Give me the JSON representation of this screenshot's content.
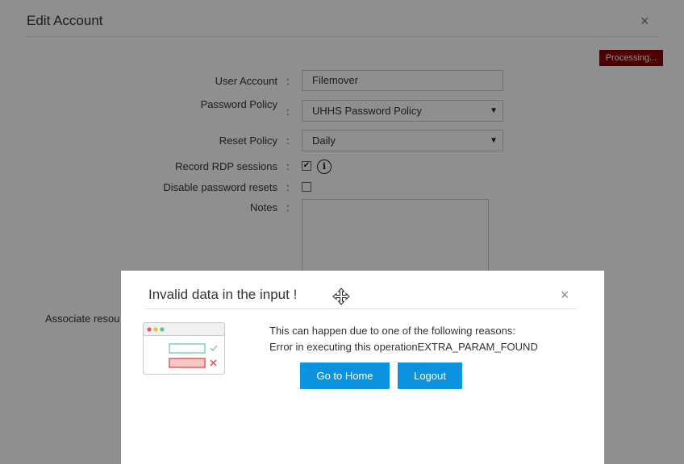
{
  "edit_account": {
    "title": "Edit Account",
    "close_symbol": "×",
    "processing_label": "Processing...",
    "colon": ":",
    "fields": {
      "user_account": {
        "label": "User Account",
        "value": "Filemover"
      },
      "password_policy": {
        "label": "Password Policy",
        "value": "UHHS Password Policy"
      },
      "reset_policy": {
        "label": "Reset Policy",
        "value": "Daily"
      },
      "record_rdp": {
        "label": "Record RDP sessions",
        "checked": true
      },
      "disable_resets": {
        "label": "Disable password resets",
        "checked": false
      },
      "notes": {
        "label": "Notes",
        "value": ""
      }
    },
    "associate_label": "Associate resou",
    "checkmark": "✔",
    "dropdown_arrow": "▼",
    "info_symbol": "i"
  },
  "modal": {
    "title": "Invalid data in the input !",
    "close_symbol": "×",
    "message_line1": "This can happen due to one of the following reasons:",
    "message_line2": "Error in executing this operationEXTRA_PARAM_FOUND",
    "go_home_label": "Go to Home",
    "logout_label": "Logout",
    "icons": {
      "move": "move-icon",
      "illustration": "invalid-form-illustration-icon"
    }
  },
  "colors": {
    "processing_badge": "#8b0000",
    "button_primary": "#0b93e0",
    "valid_green": "#7ed3b2",
    "invalid_red": "#e9575b"
  }
}
